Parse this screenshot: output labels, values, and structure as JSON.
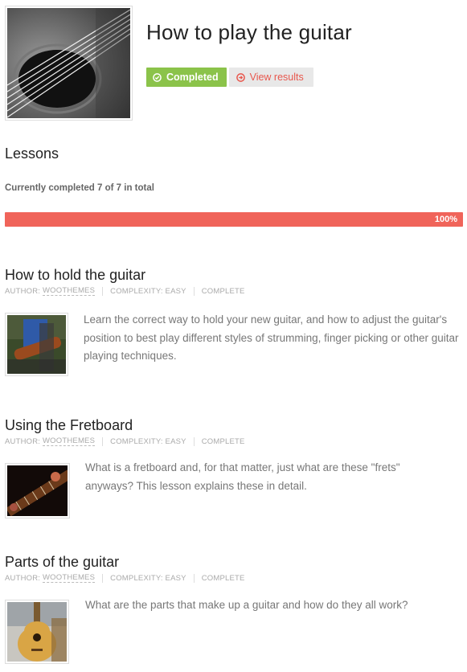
{
  "course": {
    "title": "How to play the guitar",
    "status_badge": "Completed",
    "view_results": "View results"
  },
  "lessons_section": {
    "heading": "Lessons",
    "progress_text": "Currently completed 7 of 7 in total",
    "progress_percent": 100,
    "progress_label": "100%"
  },
  "lessons": [
    {
      "title": "How to hold the guitar",
      "author_label": "AUTHOR:",
      "author": "WOOTHEMES",
      "complexity": "COMPLEXITY: EASY",
      "status": "COMPLETE",
      "excerpt": "Learn the correct way to hold your new guitar, and how to adjust the guitar's position to best play different styles of strumming, finger picking or other guitar playing techniques."
    },
    {
      "title": "Using the Fretboard",
      "author_label": "AUTHOR:",
      "author": "WOOTHEMES",
      "complexity": "COMPLEXITY: EASY",
      "status": "COMPLETE",
      "excerpt": "What is a fretboard and, for that matter, just what are these \"frets\" anyways? This lesson explains these in detail."
    },
    {
      "title": "Parts of the guitar",
      "author_label": "AUTHOR:",
      "author": "WOOTHEMES",
      "complexity": "COMPLEXITY: EASY",
      "status": "COMPLETE",
      "excerpt": "What are the parts that make up a guitar and how do they all work?"
    }
  ],
  "colors": {
    "completed_badge": "#8bc34a",
    "accent_red": "#f0645a",
    "view_results_text": "#e8574d"
  }
}
